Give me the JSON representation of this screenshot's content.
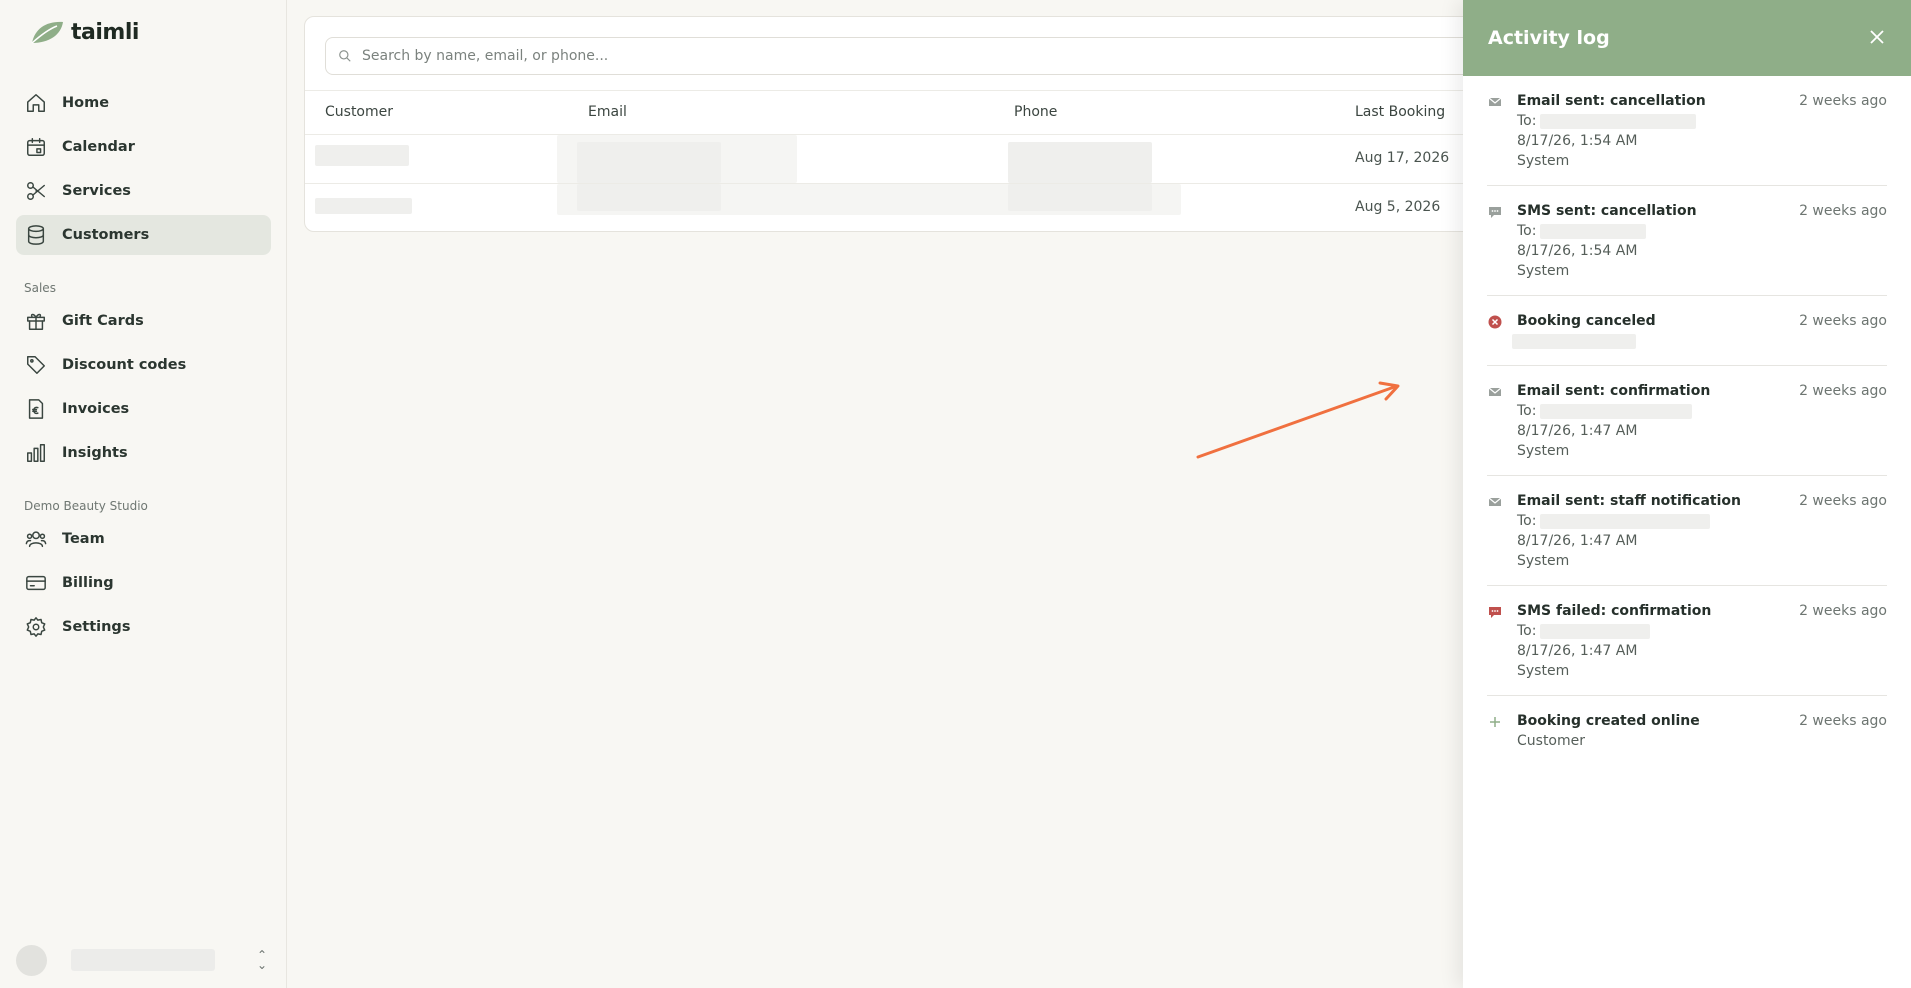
{
  "app": {
    "name": "taimli"
  },
  "sidebar": {
    "main_items": [
      {
        "label": "Home",
        "icon": "home-icon"
      },
      {
        "label": "Calendar",
        "icon": "calendar-icon"
      },
      {
        "label": "Services",
        "icon": "scissors-icon"
      },
      {
        "label": "Customers",
        "icon": "database-icon",
        "active": true
      }
    ],
    "sales_label": "Sales",
    "sales_items": [
      {
        "label": "Gift Cards",
        "icon": "gift-icon"
      },
      {
        "label": "Discount codes",
        "icon": "tag-icon"
      },
      {
        "label": "Invoices",
        "icon": "invoice-icon"
      },
      {
        "label": "Insights",
        "icon": "bar-chart-icon"
      }
    ],
    "org_label": "Demo Beauty Studio",
    "org_items": [
      {
        "label": "Team",
        "icon": "users-icon"
      },
      {
        "label": "Billing",
        "icon": "credit-card-icon"
      },
      {
        "label": "Settings",
        "icon": "gear-icon"
      }
    ]
  },
  "search": {
    "placeholder": "Search by name, email, or phone..."
  },
  "table": {
    "columns": [
      "Customer",
      "Email",
      "Phone",
      "Last Booking"
    ],
    "rows": [
      {
        "last_booking": "Aug 17, 2026"
      },
      {
        "last_booking": "Aug 5, 2026"
      }
    ]
  },
  "activity_log": {
    "title": "Activity log",
    "entries": [
      {
        "icon": "mail-icon",
        "title": "Email sent: cancellation",
        "time": "2 weeks ago",
        "to_label": "To:",
        "date": "8/17/26, 1:54 AM",
        "actor": "System"
      },
      {
        "icon": "message-icon",
        "title": "SMS sent: cancellation",
        "time": "2 weeks ago",
        "to_label": "To:",
        "date": "8/17/26, 1:54 AM",
        "actor": "System"
      },
      {
        "icon": "cancel-circle-icon",
        "title": "Booking canceled",
        "time": "2 weeks ago"
      },
      {
        "icon": "mail-icon",
        "title": "Email sent: confirmation",
        "time": "2 weeks ago",
        "to_label": "To:",
        "date": "8/17/26, 1:47 AM",
        "actor": "System"
      },
      {
        "icon": "mail-icon",
        "title": "Email sent: staff notification",
        "time": "2 weeks ago",
        "to_label": "To:",
        "date": "8/17/26, 1:47 AM",
        "actor": "System"
      },
      {
        "icon": "message-failed-icon",
        "title": "SMS failed: confirmation",
        "time": "2 weeks ago",
        "to_label": "To:",
        "date": "8/17/26, 1:47 AM",
        "actor": "System"
      },
      {
        "icon": "plus-icon",
        "title": "Booking created online",
        "time": "2 weeks ago",
        "actor": "Customer"
      }
    ]
  },
  "colors": {
    "header": "#8fae88",
    "active_nav": "#e4e7e0",
    "arrow": "#f0703f",
    "error": "#c0504d"
  }
}
